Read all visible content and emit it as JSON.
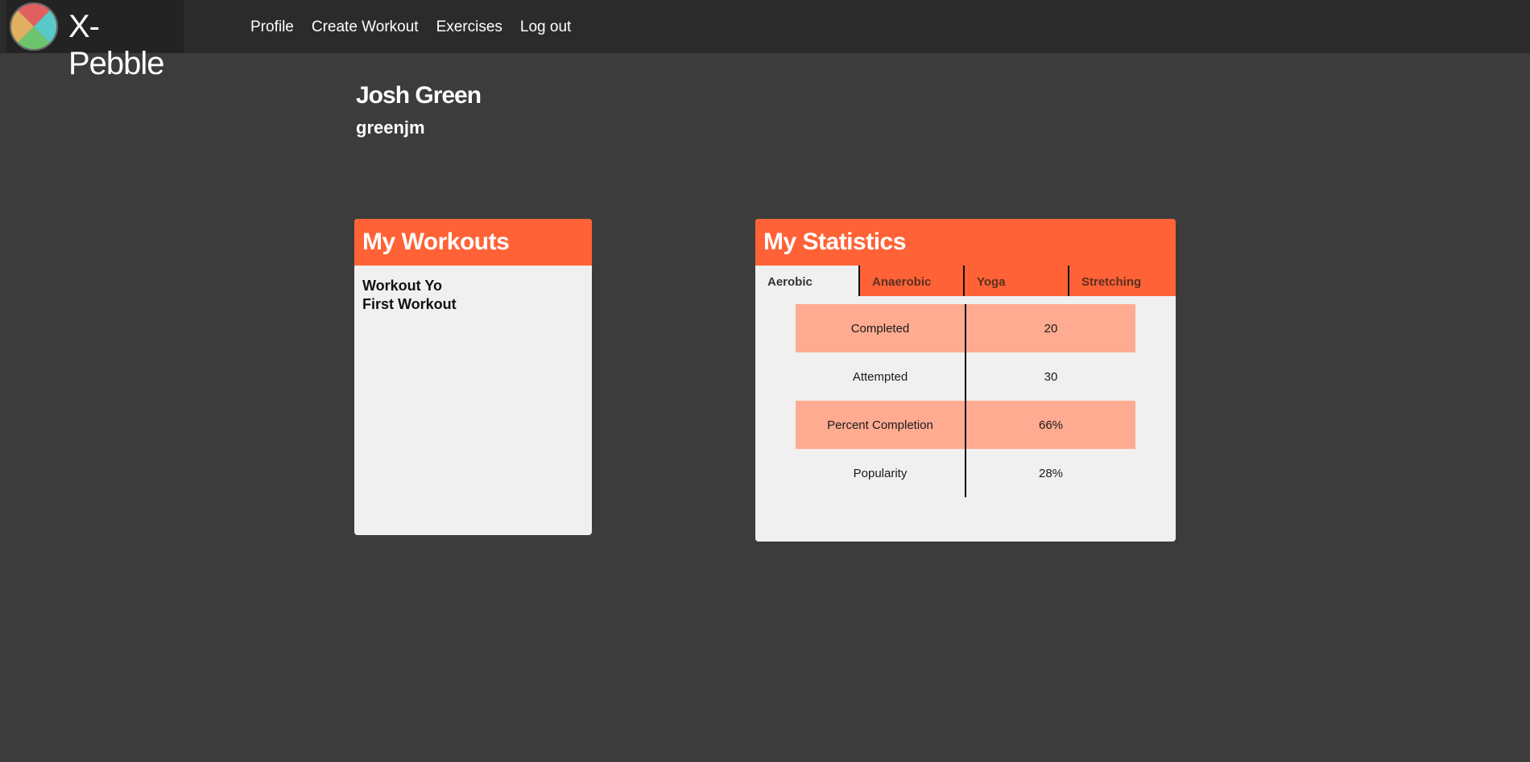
{
  "brand": {
    "name": "X-Pebble"
  },
  "nav": {
    "items": [
      {
        "label": "Profile"
      },
      {
        "label": "Create Workout"
      },
      {
        "label": "Exercises"
      },
      {
        "label": "Log out"
      }
    ]
  },
  "user": {
    "full_name": "Josh Green",
    "username": "greenjm"
  },
  "workouts": {
    "title": "My Workouts",
    "items": [
      "Workout Yo",
      "First Workout"
    ]
  },
  "statistics": {
    "title": "My Statistics",
    "tabs": [
      "Aerobic",
      "Anaerobic",
      "Yoga",
      "Stretching"
    ],
    "active_tab": "Aerobic",
    "rows": [
      {
        "label": "Completed",
        "value": "20"
      },
      {
        "label": "Attempted",
        "value": "30"
      },
      {
        "label": "Percent Completion",
        "value": "66%"
      },
      {
        "label": "Popularity",
        "value": "28%"
      }
    ]
  },
  "colors": {
    "accent": "#ff6236",
    "row_highlight": "#ffab91",
    "background": "#3c3c3c",
    "navbar": "#2b2b2b"
  }
}
